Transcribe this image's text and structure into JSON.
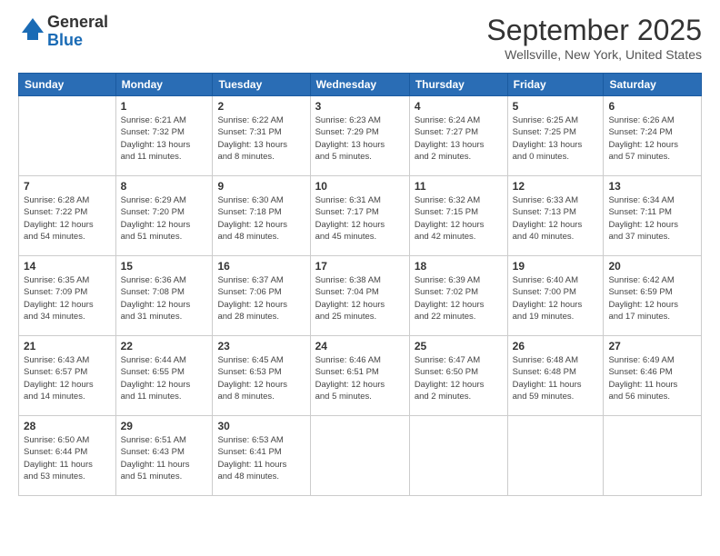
{
  "logo": {
    "line1": "General",
    "line2": "Blue"
  },
  "header": {
    "month": "September 2025",
    "location": "Wellsville, New York, United States"
  },
  "weekdays": [
    "Sunday",
    "Monday",
    "Tuesday",
    "Wednesday",
    "Thursday",
    "Friday",
    "Saturday"
  ],
  "weeks": [
    [
      {
        "day": "",
        "info": ""
      },
      {
        "day": "1",
        "info": "Sunrise: 6:21 AM\nSunset: 7:32 PM\nDaylight: 13 hours\nand 11 minutes."
      },
      {
        "day": "2",
        "info": "Sunrise: 6:22 AM\nSunset: 7:31 PM\nDaylight: 13 hours\nand 8 minutes."
      },
      {
        "day": "3",
        "info": "Sunrise: 6:23 AM\nSunset: 7:29 PM\nDaylight: 13 hours\nand 5 minutes."
      },
      {
        "day": "4",
        "info": "Sunrise: 6:24 AM\nSunset: 7:27 PM\nDaylight: 13 hours\nand 2 minutes."
      },
      {
        "day": "5",
        "info": "Sunrise: 6:25 AM\nSunset: 7:25 PM\nDaylight: 13 hours\nand 0 minutes."
      },
      {
        "day": "6",
        "info": "Sunrise: 6:26 AM\nSunset: 7:24 PM\nDaylight: 12 hours\nand 57 minutes."
      }
    ],
    [
      {
        "day": "7",
        "info": "Sunrise: 6:28 AM\nSunset: 7:22 PM\nDaylight: 12 hours\nand 54 minutes."
      },
      {
        "day": "8",
        "info": "Sunrise: 6:29 AM\nSunset: 7:20 PM\nDaylight: 12 hours\nand 51 minutes."
      },
      {
        "day": "9",
        "info": "Sunrise: 6:30 AM\nSunset: 7:18 PM\nDaylight: 12 hours\nand 48 minutes."
      },
      {
        "day": "10",
        "info": "Sunrise: 6:31 AM\nSunset: 7:17 PM\nDaylight: 12 hours\nand 45 minutes."
      },
      {
        "day": "11",
        "info": "Sunrise: 6:32 AM\nSunset: 7:15 PM\nDaylight: 12 hours\nand 42 minutes."
      },
      {
        "day": "12",
        "info": "Sunrise: 6:33 AM\nSunset: 7:13 PM\nDaylight: 12 hours\nand 40 minutes."
      },
      {
        "day": "13",
        "info": "Sunrise: 6:34 AM\nSunset: 7:11 PM\nDaylight: 12 hours\nand 37 minutes."
      }
    ],
    [
      {
        "day": "14",
        "info": "Sunrise: 6:35 AM\nSunset: 7:09 PM\nDaylight: 12 hours\nand 34 minutes."
      },
      {
        "day": "15",
        "info": "Sunrise: 6:36 AM\nSunset: 7:08 PM\nDaylight: 12 hours\nand 31 minutes."
      },
      {
        "day": "16",
        "info": "Sunrise: 6:37 AM\nSunset: 7:06 PM\nDaylight: 12 hours\nand 28 minutes."
      },
      {
        "day": "17",
        "info": "Sunrise: 6:38 AM\nSunset: 7:04 PM\nDaylight: 12 hours\nand 25 minutes."
      },
      {
        "day": "18",
        "info": "Sunrise: 6:39 AM\nSunset: 7:02 PM\nDaylight: 12 hours\nand 22 minutes."
      },
      {
        "day": "19",
        "info": "Sunrise: 6:40 AM\nSunset: 7:00 PM\nDaylight: 12 hours\nand 19 minutes."
      },
      {
        "day": "20",
        "info": "Sunrise: 6:42 AM\nSunset: 6:59 PM\nDaylight: 12 hours\nand 17 minutes."
      }
    ],
    [
      {
        "day": "21",
        "info": "Sunrise: 6:43 AM\nSunset: 6:57 PM\nDaylight: 12 hours\nand 14 minutes."
      },
      {
        "day": "22",
        "info": "Sunrise: 6:44 AM\nSunset: 6:55 PM\nDaylight: 12 hours\nand 11 minutes."
      },
      {
        "day": "23",
        "info": "Sunrise: 6:45 AM\nSunset: 6:53 PM\nDaylight: 12 hours\nand 8 minutes."
      },
      {
        "day": "24",
        "info": "Sunrise: 6:46 AM\nSunset: 6:51 PM\nDaylight: 12 hours\nand 5 minutes."
      },
      {
        "day": "25",
        "info": "Sunrise: 6:47 AM\nSunset: 6:50 PM\nDaylight: 12 hours\nand 2 minutes."
      },
      {
        "day": "26",
        "info": "Sunrise: 6:48 AM\nSunset: 6:48 PM\nDaylight: 11 hours\nand 59 minutes."
      },
      {
        "day": "27",
        "info": "Sunrise: 6:49 AM\nSunset: 6:46 PM\nDaylight: 11 hours\nand 56 minutes."
      }
    ],
    [
      {
        "day": "28",
        "info": "Sunrise: 6:50 AM\nSunset: 6:44 PM\nDaylight: 11 hours\nand 53 minutes."
      },
      {
        "day": "29",
        "info": "Sunrise: 6:51 AM\nSunset: 6:43 PM\nDaylight: 11 hours\nand 51 minutes."
      },
      {
        "day": "30",
        "info": "Sunrise: 6:53 AM\nSunset: 6:41 PM\nDaylight: 11 hours\nand 48 minutes."
      },
      {
        "day": "",
        "info": ""
      },
      {
        "day": "",
        "info": ""
      },
      {
        "day": "",
        "info": ""
      },
      {
        "day": "",
        "info": ""
      }
    ]
  ]
}
